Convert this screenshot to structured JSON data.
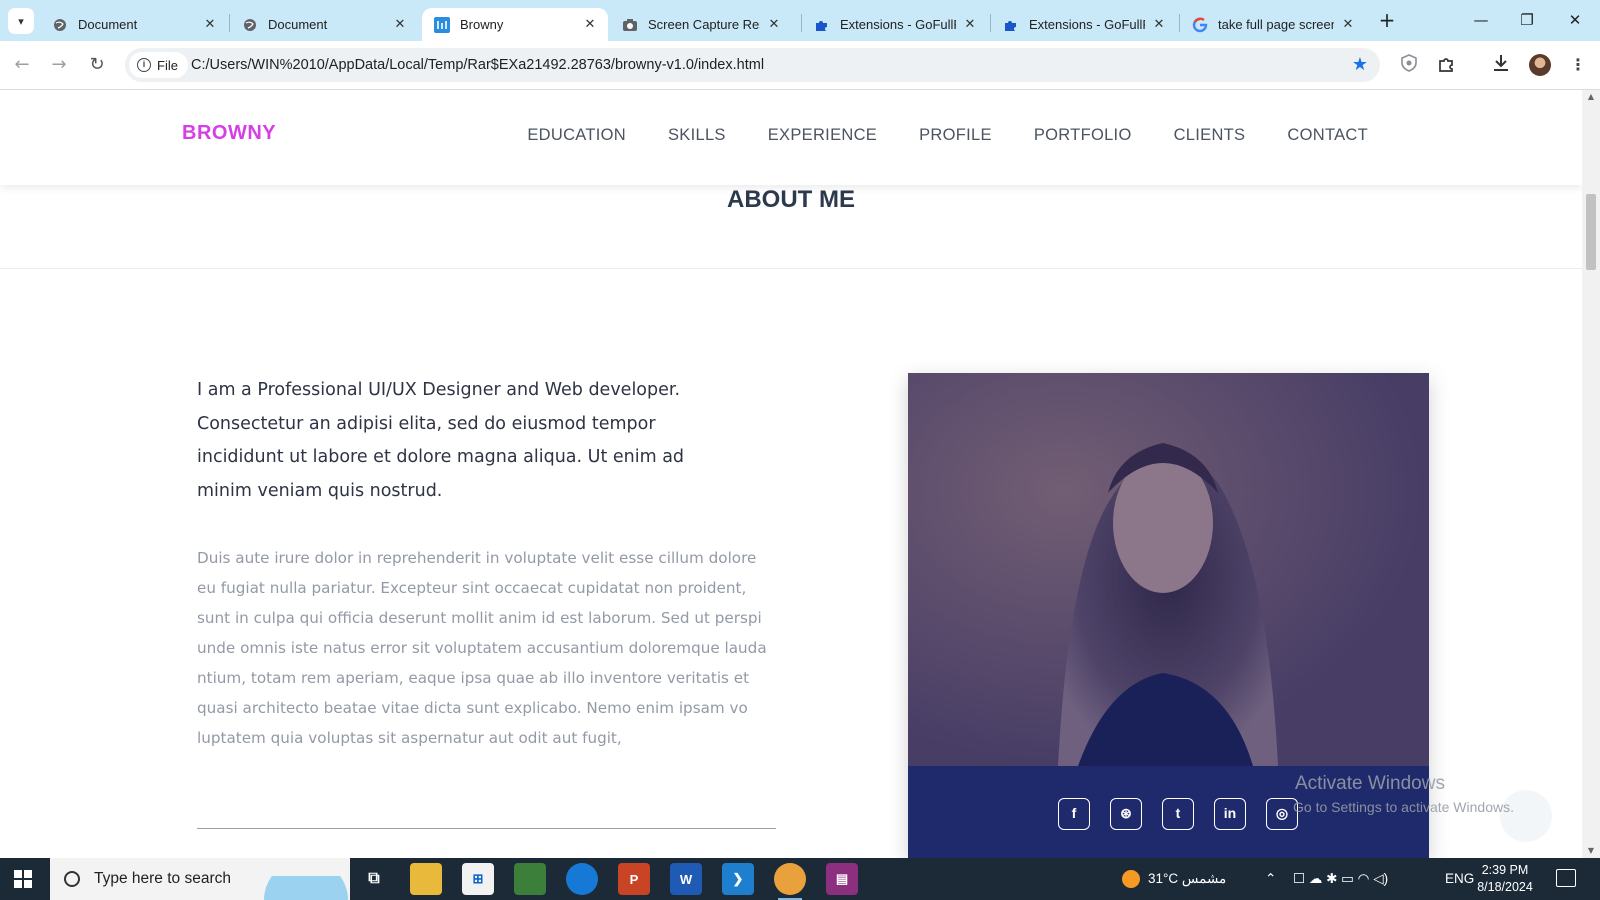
{
  "browser": {
    "tabs": [
      {
        "title": "Document",
        "icon": "globe-icon",
        "active": false
      },
      {
        "title": "Document",
        "icon": "globe-icon",
        "active": false
      },
      {
        "title": "Browny",
        "icon": "site-favicon-icon",
        "active": true
      },
      {
        "title": "Screen Capture Result",
        "icon": "camera-icon",
        "active": false
      },
      {
        "title": "Extensions - GoFullPage",
        "icon": "puzzle-icon",
        "active": false
      },
      {
        "title": "Extensions - GoFullPage",
        "icon": "puzzle-icon",
        "active": false
      },
      {
        "title": "take full page screen",
        "icon": "google-icon",
        "active": false
      }
    ],
    "address": {
      "chip": "File",
      "url": "C:/Users/WIN%2010/AppData/Local/Temp/Rar$EXa21492.28763/browny-v1.0/index.html"
    }
  },
  "site": {
    "brand": "BROWNY",
    "brand_color": "#d63ee6",
    "nav": [
      "EDUCATION",
      "SKILLS",
      "EXPERIENCE",
      "PROFILE",
      "PORTFOLIO",
      "CLIENTS",
      "CONTACT"
    ],
    "section_title": "ABOUT ME",
    "lead": "I am a Professional UI/UX Designer and Web developer. Consectetur an adipisi elita, sed do eiusmod tempor incididunt ut labore et dolore magna aliqua. Ut enim ad minim veniam quis nostrud.",
    "body": "Duis aute irure dolor in reprehenderit in voluptate velit esse cillum dolore eu fugiat nulla pariatur. Excepteur sint occaecat cupidatat non proident, sunt in culpa qui officia deserunt mollit anim id est laborum. Sed ut perspi unde omnis iste natus error sit voluptatem accusantium doloremque lauda ntium, totam rem aperiam, eaque ipsa quae ab illo inventore veritatis et quasi architecto beatae vitae dicta sunt explicabo. Nemo enim ipsam vo luptatem quia voluptas sit aspernatur aut odit aut fugit,",
    "social": [
      {
        "icon": "facebook-icon",
        "glyph": "f"
      },
      {
        "icon": "dribbble-icon",
        "glyph": "⊛"
      },
      {
        "icon": "twitter-icon",
        "glyph": "t"
      },
      {
        "icon": "linkedin-icon",
        "glyph": "in"
      },
      {
        "icon": "instagram-icon",
        "glyph": "◎"
      }
    ],
    "social_bar_color": "#1f2a6c"
  },
  "watermark": {
    "line1": "Activate Windows",
    "line2": "Go to Settings to activate Windows."
  },
  "taskbar": {
    "search_placeholder": "Type here to search",
    "weather": "31°C  مشمس",
    "language": "ENG",
    "time": "2:39 PM",
    "date": "8/18/2024"
  }
}
